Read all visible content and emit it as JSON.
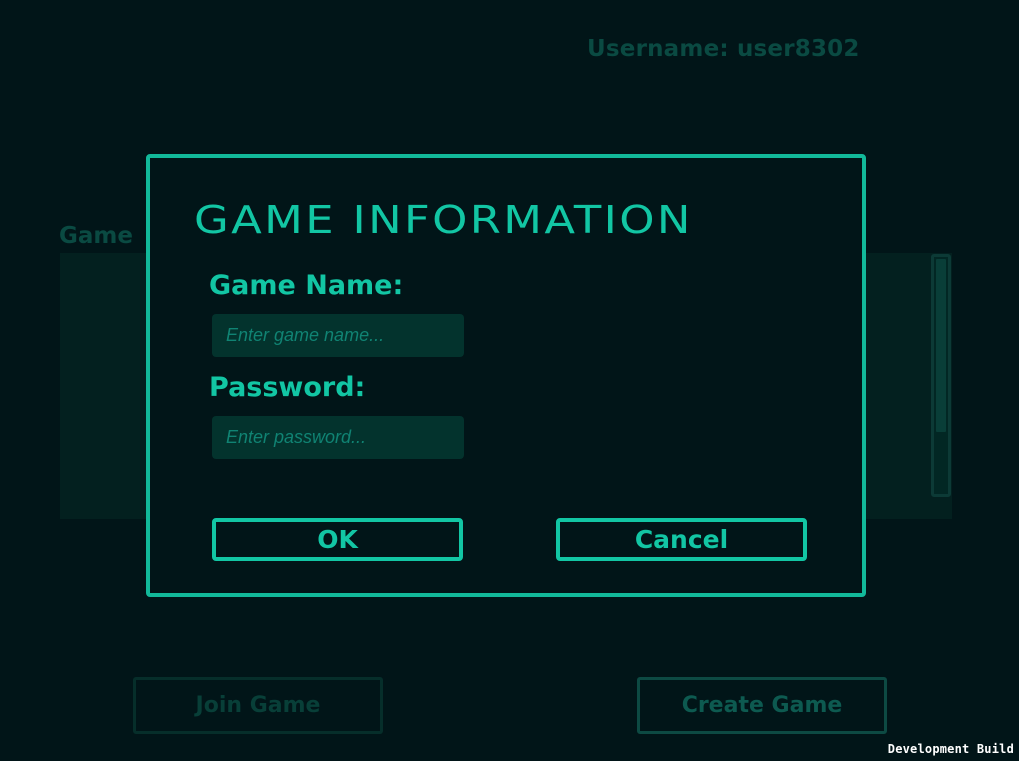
{
  "header": {
    "username_text": "Username: user8302"
  },
  "lobby": {
    "list_title": "Game",
    "join_label": "Join Game",
    "create_label": "Create Game"
  },
  "dialog": {
    "title": "Game Information",
    "name_label": "Game Name:",
    "name_placeholder": "Enter game name...",
    "name_value": "",
    "password_label": "Password:",
    "password_placeholder": "Enter password...",
    "password_value": "",
    "ok_label": "OK",
    "cancel_label": "Cancel"
  },
  "footer": {
    "build_text": "Development Build"
  },
  "colors": {
    "accent": "#12c6a4",
    "background": "#011518",
    "field_bg": "#03332d",
    "dimmed_text": "#0a4a42"
  }
}
